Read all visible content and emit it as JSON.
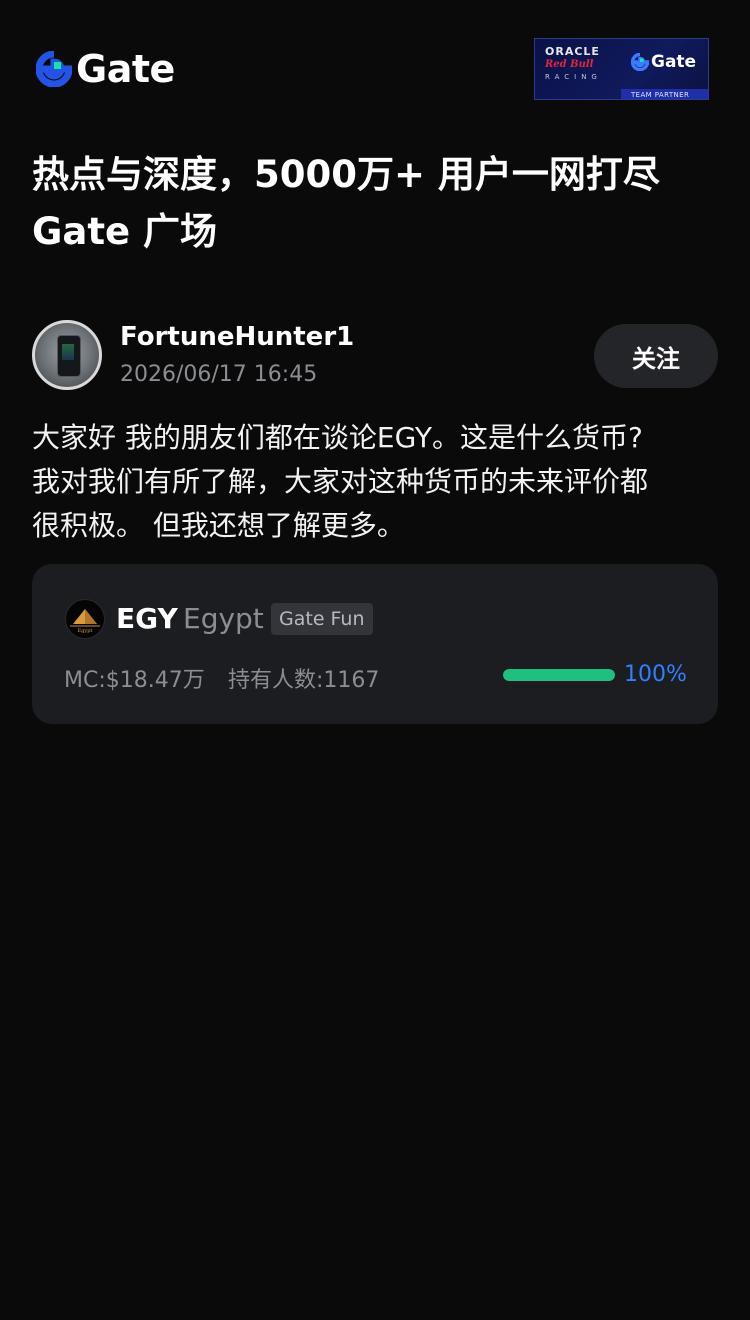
{
  "header": {
    "logo_text": "Gate",
    "partner": {
      "oracle_text": "ORACLE",
      "redbull_text": "Red Bull",
      "racing_text": "RACING",
      "gate_text": "Gate",
      "strip_text": "TEAM PARTNER"
    }
  },
  "headline": {
    "line1": "热点与深度，5000万+ 用户一网打尽",
    "line2": "Gate 广场"
  },
  "post": {
    "author_name": "FortuneHunter1",
    "timestamp": "2026/06/17 16:45",
    "follow_label": "关注",
    "body_lines": [
      "大家好 我的朋友们都在谈论EGY。这是什么货币?",
      "我对我们有所了解，大家对这种货币的未来评价都",
      "很积极。 但我还想了解更多。"
    ]
  },
  "token": {
    "symbol": "EGY",
    "name": "Egypt",
    "icon_caption": "Egypt",
    "tag": "Gate Fun",
    "market_cap": "MC:$18.47万",
    "holders": "持有人数:1167",
    "progress_percent": 100,
    "progress_label": "100%"
  },
  "colors": {
    "background": "#0a0a0a",
    "card": "#1c1d21",
    "progress": "#1fc07f",
    "progress_label": "#2f80ff",
    "logo_blue": "#2354e6",
    "logo_cyan": "#17e6a1"
  }
}
